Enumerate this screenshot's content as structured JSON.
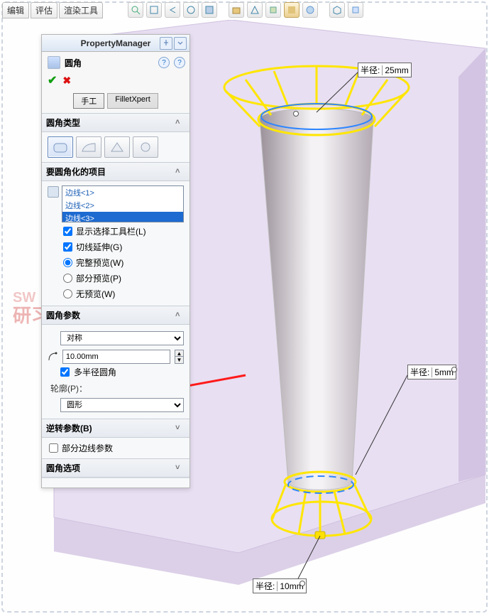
{
  "menu": {
    "edit": "编辑",
    "evaluate": "评估",
    "render": "渲染工具"
  },
  "panel": {
    "title": "PropertyManager",
    "feature": "圆角",
    "tabs": {
      "manual": "手工",
      "xpert": "FilletXpert"
    },
    "section_type": "圆角类型",
    "section_items": "要圆角化的项目",
    "edges": [
      "边线<1>",
      "边线<2>",
      "边线<3>"
    ],
    "ck_showtoolbar": "显示选择工具栏(L)",
    "ck_tangent": "切线延伸(G)",
    "rb_fullprev": "完整预览(W)",
    "rb_partprev": "部分预览(P)",
    "rb_noprev": "无预览(W)",
    "section_params": "圆角参数",
    "symmetric": "对称",
    "radius_value": "10.00mm",
    "ck_multi": "多半径圆角",
    "profile_label": "轮廓(P)：",
    "profile_value": "圆形",
    "section_reverse": "逆转参数(B)",
    "ck_partial": "部分边线参数",
    "section_options": "圆角选项"
  },
  "callouts": {
    "label": "半径:",
    "r_top": "25mm",
    "r_mid": "5mm",
    "r_bot": "10mm"
  },
  "watermark": {
    "l1": "SW",
    "l2": "研习社"
  }
}
